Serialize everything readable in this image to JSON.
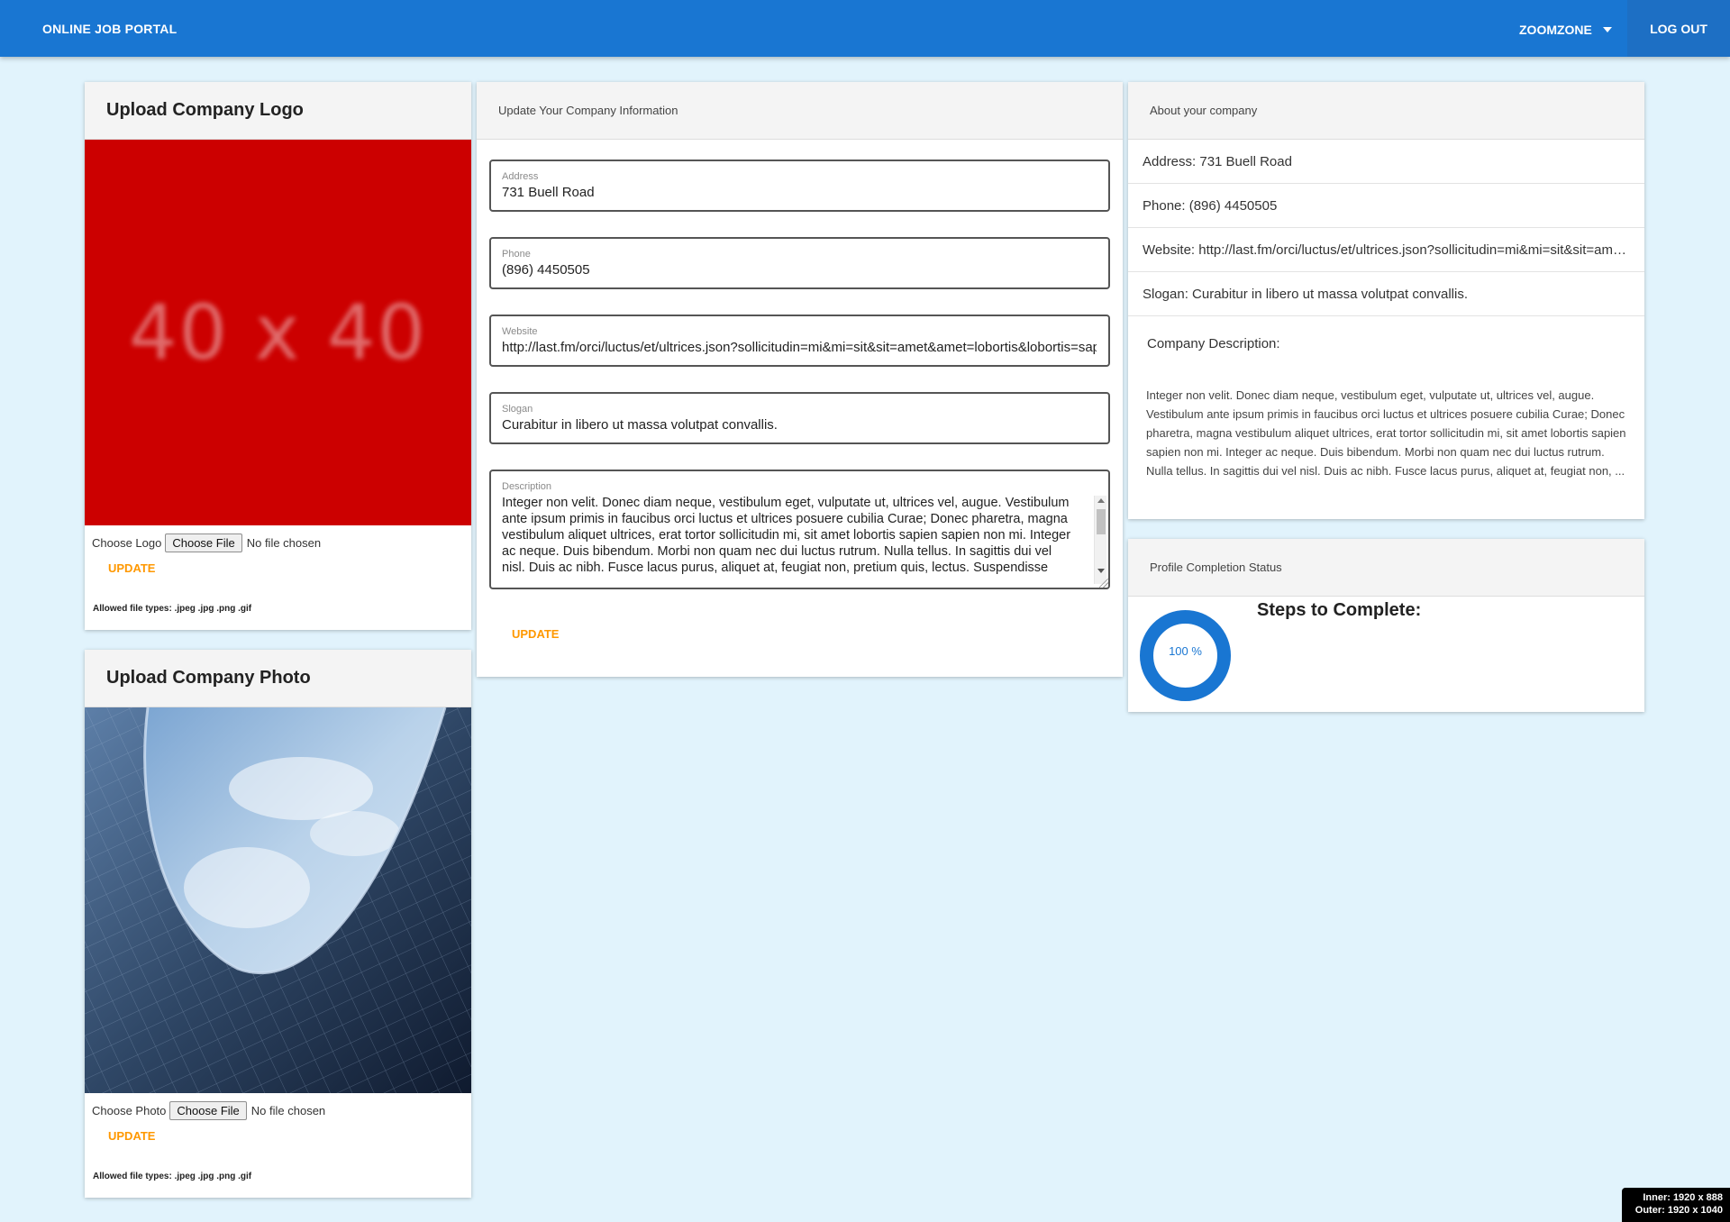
{
  "nav": {
    "brand": "ONLINE JOB PORTAL",
    "user": "ZOOMZONE",
    "logout": "LOG OUT"
  },
  "logo_card": {
    "title": "Upload Company Logo",
    "placeholder": "40 x 40",
    "choose_label": "Choose Logo",
    "choose_button": "Choose File",
    "file_status": "No file chosen",
    "update": "UPDATE",
    "allowed": "Allowed file types: .jpeg .jpg .png .gif"
  },
  "photo_card": {
    "title": "Upload Company Photo",
    "choose_label": "Choose Photo",
    "choose_button": "Choose File",
    "file_status": "No file chosen",
    "update": "UPDATE",
    "allowed": "Allowed file types: .jpeg .jpg .png .gif"
  },
  "form": {
    "title": "Update Your Company Information",
    "address_label": "Address",
    "address": "731 Buell Road",
    "phone_label": "Phone",
    "phone": "(896) 4450505",
    "website_label": "Website",
    "website": "http://last.fm/orci/luctus/et/ultrices.json?sollicitudin=mi&mi=sit&sit=amet&amet=lobortis&lobortis=sapien",
    "slogan_label": "Slogan",
    "slogan": "Curabitur in libero ut massa volutpat convallis.",
    "description_label": "Description",
    "description": "Integer non velit. Donec diam neque, vestibulum eget, vulputate ut, ultrices vel, augue. Vestibulum ante ipsum primis in faucibus orci luctus et ultrices posuere cubilia Curae; Donec pharetra, magna vestibulum aliquet ultrices, erat tortor sollicitudin mi, sit amet lobortis sapien sapien non mi. Integer ac neque. Duis bibendum. Morbi non quam nec dui luctus rutrum. Nulla tellus. In sagittis dui vel nisl. Duis ac nibh. Fusce lacus purus, aliquet at, feugiat non, pretium quis, lectus. Suspendisse potenti. In eleifend quam a odio. In hac habitasse platea dictumst.",
    "update": "UPDATE"
  },
  "about": {
    "title": "About your company",
    "address": "Address: 731 Buell Road",
    "phone": "Phone: (896) 4450505",
    "website": "Website: http://last.fm/orci/luctus/et/ultrices.json?sollicitudin=mi&mi=sit&sit=amet&amet=lobortis&lobortis=sapien",
    "slogan": "Slogan: Curabitur in libero ut massa volutpat convallis.",
    "description_heading": "Company Description:",
    "description": "Integer non velit. Donec diam neque, vestibulum eget, vulputate ut, ultrices vel, augue. Vestibulum ante ipsum primis in faucibus orci luctus et ultrices posuere cubilia Curae; Donec pharetra, magna vestibulum aliquet ultrices, erat tortor sollicitudin mi, sit amet lobortis sapien sapien non mi. Integer ac neque. Duis bibendum. Morbi non quam nec dui luctus rutrum. Nulla tellus. In sagittis dui vel nisl. Duis ac nibh. Fusce lacus purus, aliquet at, feugiat non, ..."
  },
  "status": {
    "title": "Profile Completion Status",
    "percent_label": "100 %",
    "completion": 1.0,
    "steps_heading": "Steps to Complete:"
  },
  "viewport_badge": {
    "inner": "Inner: 1920 x 888",
    "outer": "Outer: 1920 x 1040"
  },
  "colors": {
    "primary": "#1976d2",
    "accent": "#ff9800",
    "background": "#e1f3fc",
    "logo_placeholder_bg": "#cc0000"
  }
}
